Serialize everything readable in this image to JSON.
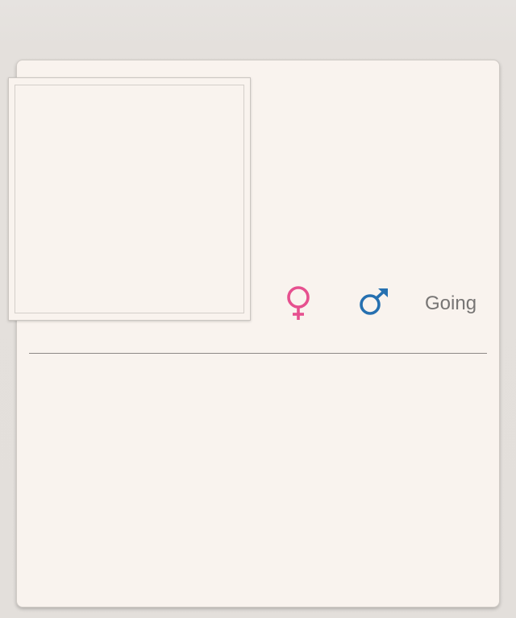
{
  "profile": {
    "photo_placeholder": "",
    "female_icon": "female-symbol-icon",
    "male_icon": "male-symbol-icon",
    "going_label": "Going"
  },
  "colors": {
    "background": "#e4e0dc",
    "card": "#f9f3ee",
    "female": "#e6508f",
    "male": "#2670b0",
    "text_muted": "#777574",
    "divider": "#8c8885"
  }
}
